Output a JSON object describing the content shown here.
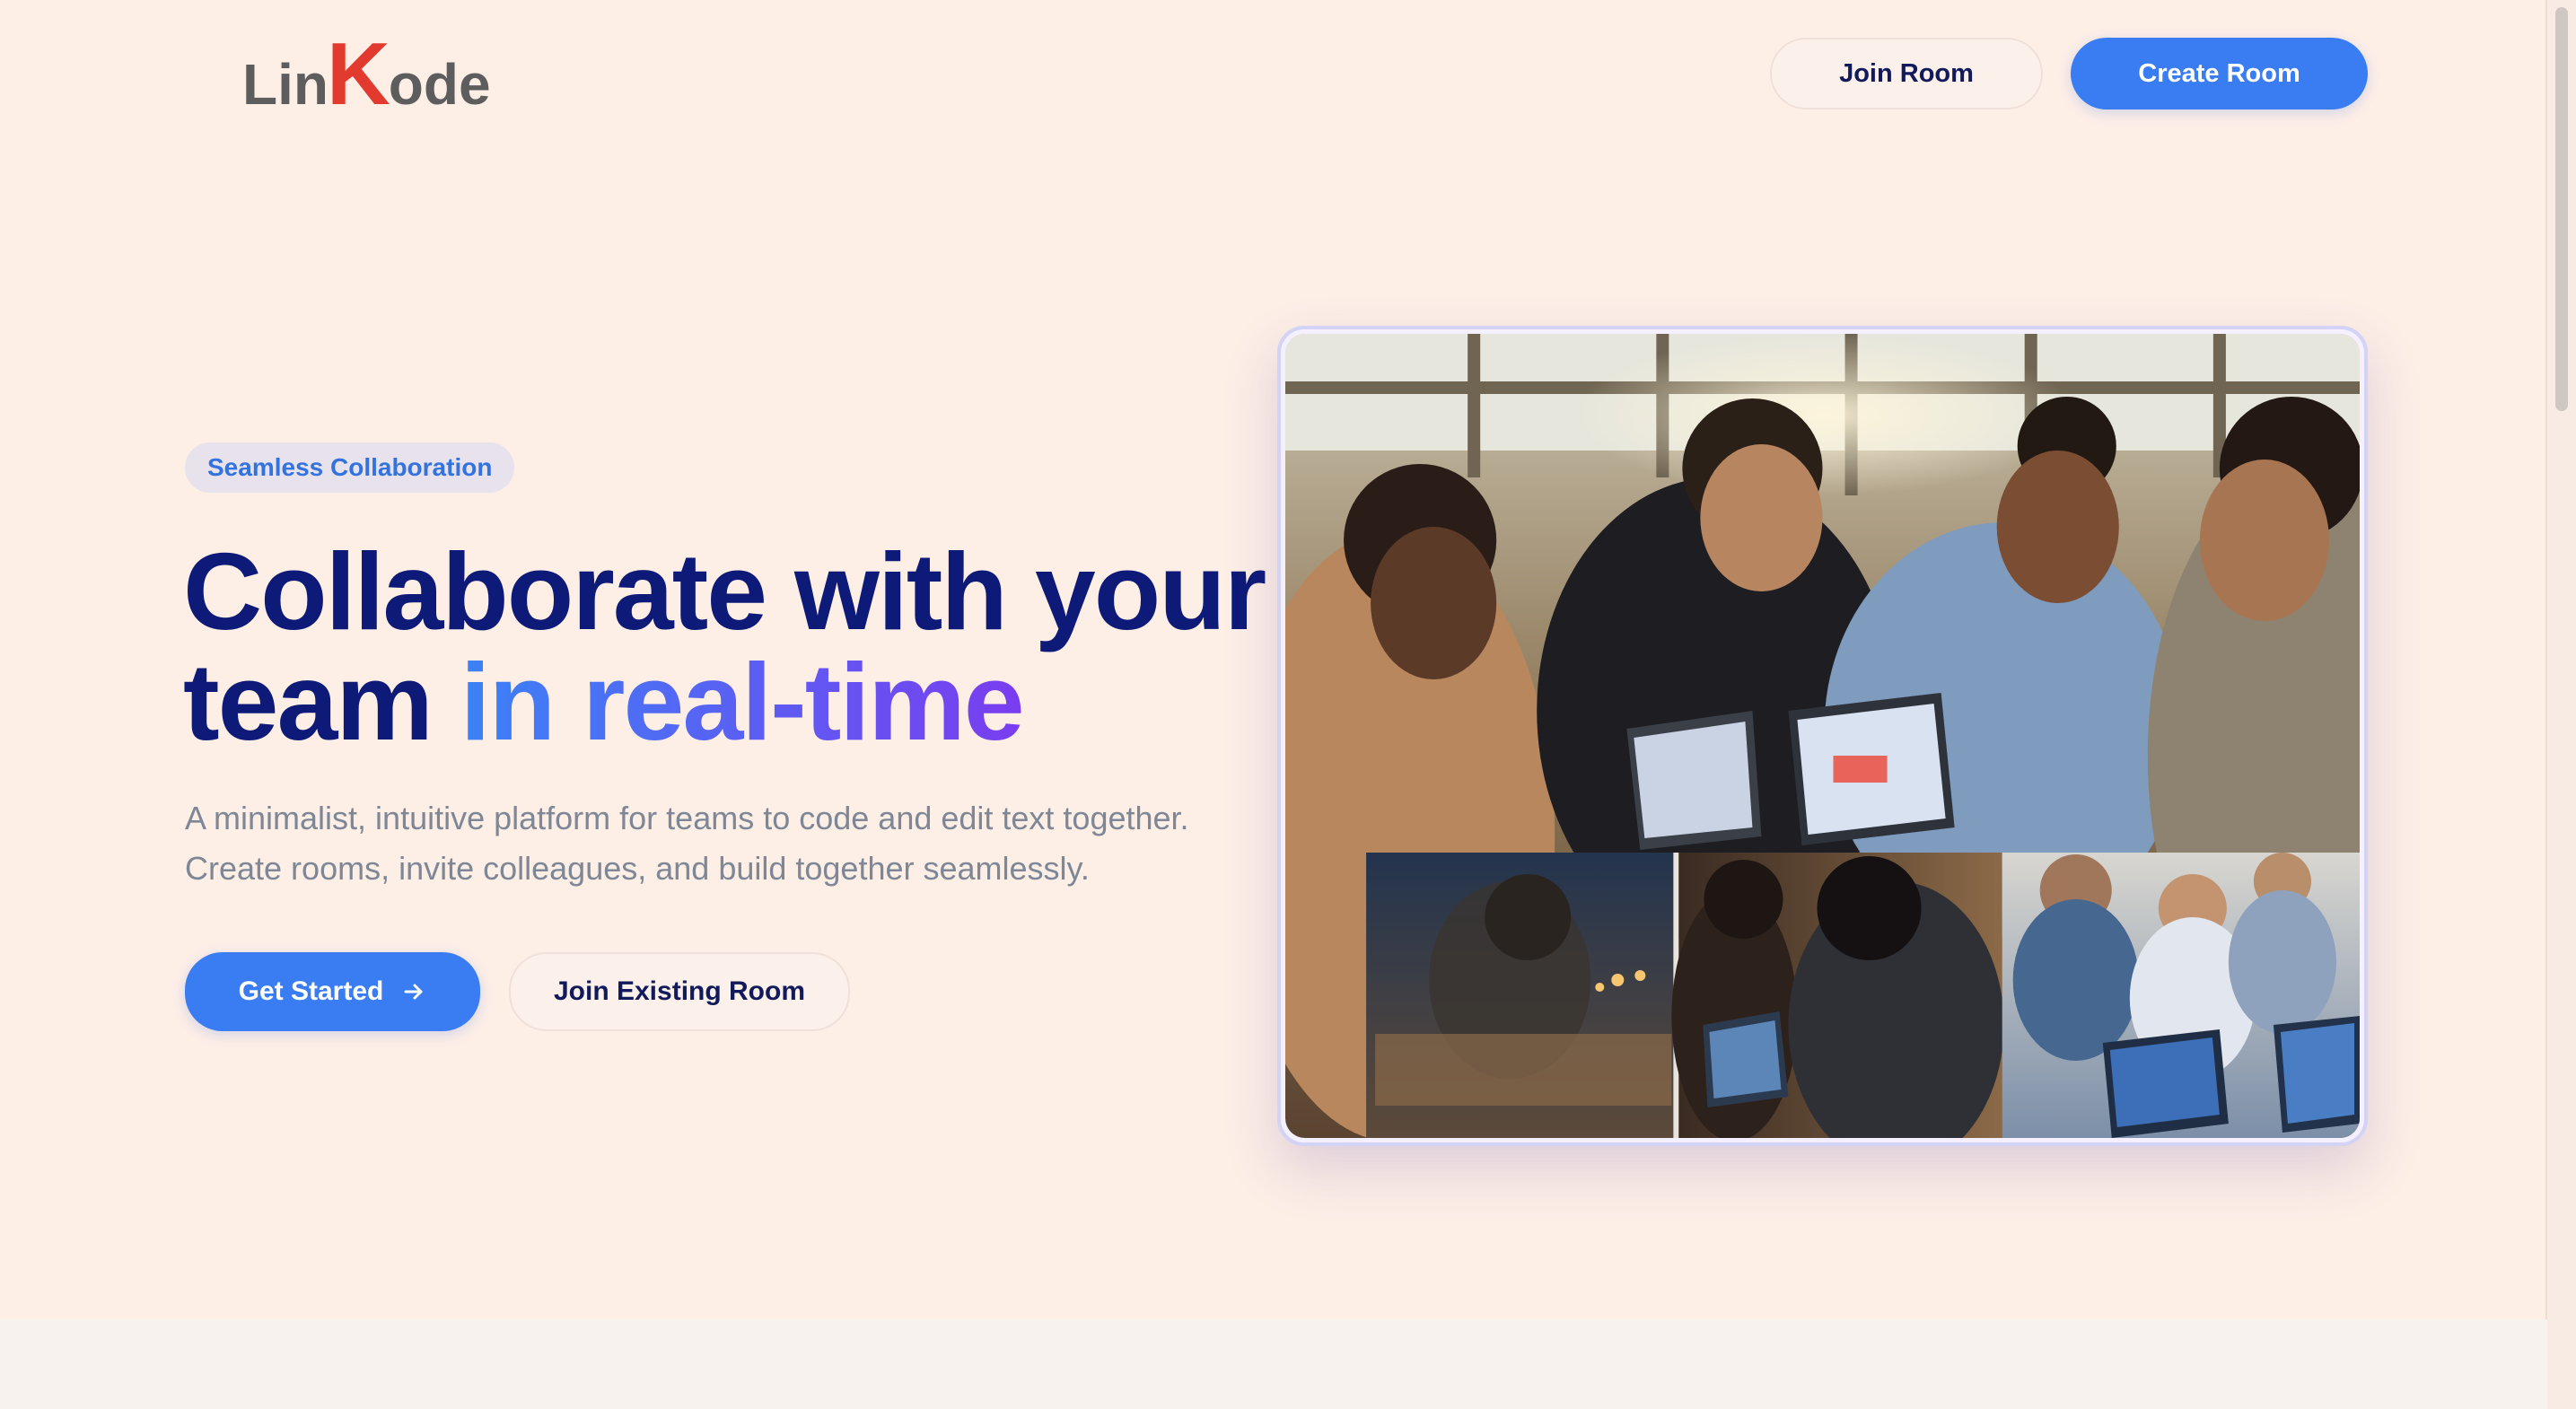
{
  "header": {
    "logo": {
      "part1": "Lin",
      "part2": "K",
      "part3": "ode"
    },
    "nav": {
      "join_room": "Join Room",
      "create_room": "Create Room"
    }
  },
  "hero": {
    "badge": "Seamless Collaboration",
    "headline": {
      "line1": "Collaborate with your",
      "line2_plain": "team ",
      "line2_highlight": "in real-time"
    },
    "description": {
      "line1": "A minimalist, intuitive platform for teams to code and edit text together.",
      "line2": "Create rooms, invite colleagues, and build together seamlessly."
    },
    "cta_primary": "Get Started",
    "cta_secondary": "Join Existing Room"
  },
  "colors": {
    "background": "#fdeee6",
    "primary": "#3a7cf2",
    "heading": "#0e1a78",
    "logo_accent": "#e23a2e",
    "gradient_start": "#3b82f6",
    "gradient_end": "#7a3df0"
  },
  "icons": {
    "cta_arrow": "arrow-right-icon"
  }
}
